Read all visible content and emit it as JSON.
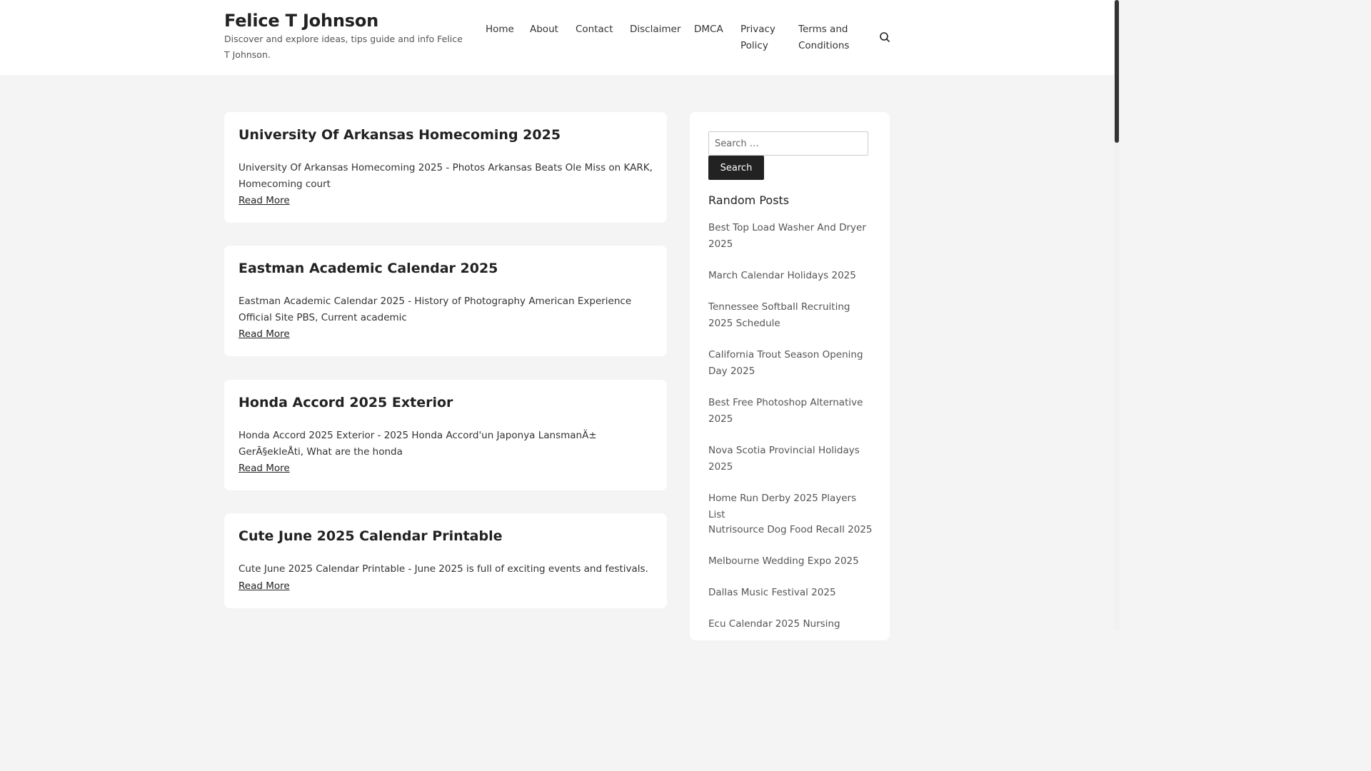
{
  "site": {
    "title": "Felice T Johnson",
    "description": "Discover and explore ideas, tips guide and info Felice T Johnson."
  },
  "nav": {
    "home": "Home",
    "about": "About",
    "contact": "Contact",
    "disclaimer": "Disclaimer",
    "dmca": "DMCA",
    "privacy_line1": "Privacy",
    "privacy_line2": "Policy",
    "terms_line1": "Terms and",
    "terms_line2": "Conditions",
    "search_icon": "search-icon"
  },
  "posts": [
    {
      "title": "University Of Arkansas Homecoming 2025",
      "excerpt": "University Of Arkansas Homecoming 2025 - Photos Arkansas Beats Ole Miss on KARK, Homecoming court",
      "read_more": "Read More"
    },
    {
      "title": "Eastman Academic Calendar 2025",
      "excerpt": "Eastman Academic Calendar 2025 - History of Photography American Experience Official Site PBS, Current academic",
      "read_more": "Read More"
    },
    {
      "title": "Honda Accord 2025 Exterior",
      "excerpt": "Honda Accord 2025 Exterior - 2025 Honda Accord'un Japonya LansmanÄ± GerÃ§ekleÅti, What are the honda",
      "read_more": "Read More"
    },
    {
      "title": "Cute June 2025 Calendar Printable",
      "excerpt": "Cute June 2025 Calendar Printable - June 2025 is full of exciting events and festivals.",
      "read_more": "Read More"
    }
  ],
  "sidebar": {
    "search_placeholder": "Search …",
    "search_button": "Search",
    "random_title": "Random Posts",
    "random_posts": [
      "Best Top Load Washer And Dryer 2025",
      "March Calendar Holidays 2025",
      "Tennessee Softball Recruiting 2025 Schedule",
      "California Trout Season Opening Day 2025",
      "Best Free Photoshop Alternative 2025",
      "Nova Scotia Provincial Holidays 2025",
      "Home Run Derby 2025 Players List",
      "Nutrisource Dog Food Recall 2025",
      "Melbourne Wedding Expo 2025",
      "Dallas Music Festival 2025",
      "Ecu Calendar 2025 Nursing"
    ]
  },
  "colors": {
    "background": "#f4f4f4",
    "card": "#ffffff",
    "button": "#222222",
    "text": "#222222",
    "muted": "#555555"
  }
}
